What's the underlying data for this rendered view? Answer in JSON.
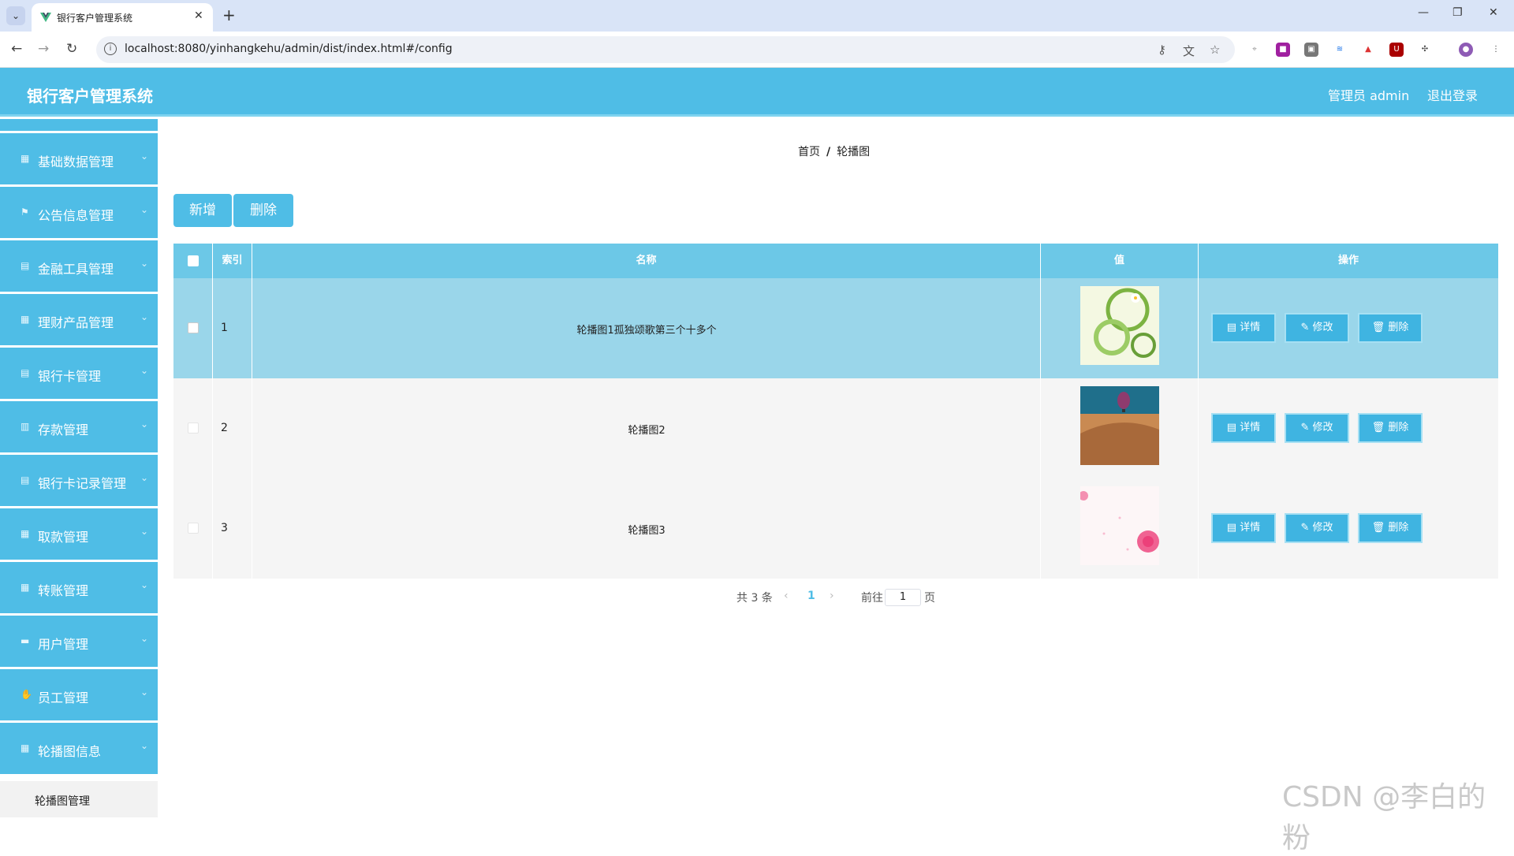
{
  "browser": {
    "tab_title": "银行客户管理系统",
    "url": "localhost:8080/yinhangkehu/admin/dist/index.html#/config"
  },
  "header": {
    "app_title": "银行客户管理系统",
    "user": "管理员 admin",
    "logout": "退出登录"
  },
  "sidebar": {
    "items": [
      {
        "label": "基础数据管理",
        "icon": "grid-icon"
      },
      {
        "label": "公告信息管理",
        "icon": "flag-icon"
      },
      {
        "label": "金融工具管理",
        "icon": "clipboard-icon"
      },
      {
        "label": "理财产品管理",
        "icon": "grid-icon"
      },
      {
        "label": "银行卡管理",
        "icon": "clipboard-icon"
      },
      {
        "label": "存款管理",
        "icon": "chart-icon"
      },
      {
        "label": "银行卡记录管理",
        "icon": "clipboard-icon"
      },
      {
        "label": "取款管理",
        "icon": "grid-icon"
      },
      {
        "label": "转账管理",
        "icon": "grid-icon"
      },
      {
        "label": "用户管理",
        "icon": "chat-icon"
      },
      {
        "label": "员工管理",
        "icon": "thumb-icon"
      },
      {
        "label": "轮播图信息",
        "icon": "grid-icon"
      }
    ],
    "active_sub": "轮播图管理"
  },
  "breadcrumb": {
    "home": "首页",
    "sep": "/",
    "current": "轮播图"
  },
  "toolbar": {
    "add": "新增",
    "delete": "删除"
  },
  "table": {
    "columns": [
      "索引",
      "名称",
      "值",
      "操作"
    ],
    "rows": [
      {
        "index": "1",
        "name": "轮播图1孤独颂歌第三个十多个",
        "image": "green-swirl"
      },
      {
        "index": "2",
        "name": "轮播图2",
        "image": "desert-balloon"
      },
      {
        "index": "3",
        "name": "轮播图3",
        "image": "pink-rose"
      }
    ],
    "actions": {
      "detail": "详情",
      "edit": "修改",
      "delete": "删除"
    }
  },
  "pager": {
    "total": "共 3 条",
    "page": "1",
    "goto": "前往",
    "page_value": "1",
    "page_unit": "页"
  },
  "watermark": "CSDN @李白的粉",
  "colors": {
    "primary": "#4fbde6",
    "header_row": "#6cc8e7",
    "selected_row": "#9ad6ea"
  }
}
